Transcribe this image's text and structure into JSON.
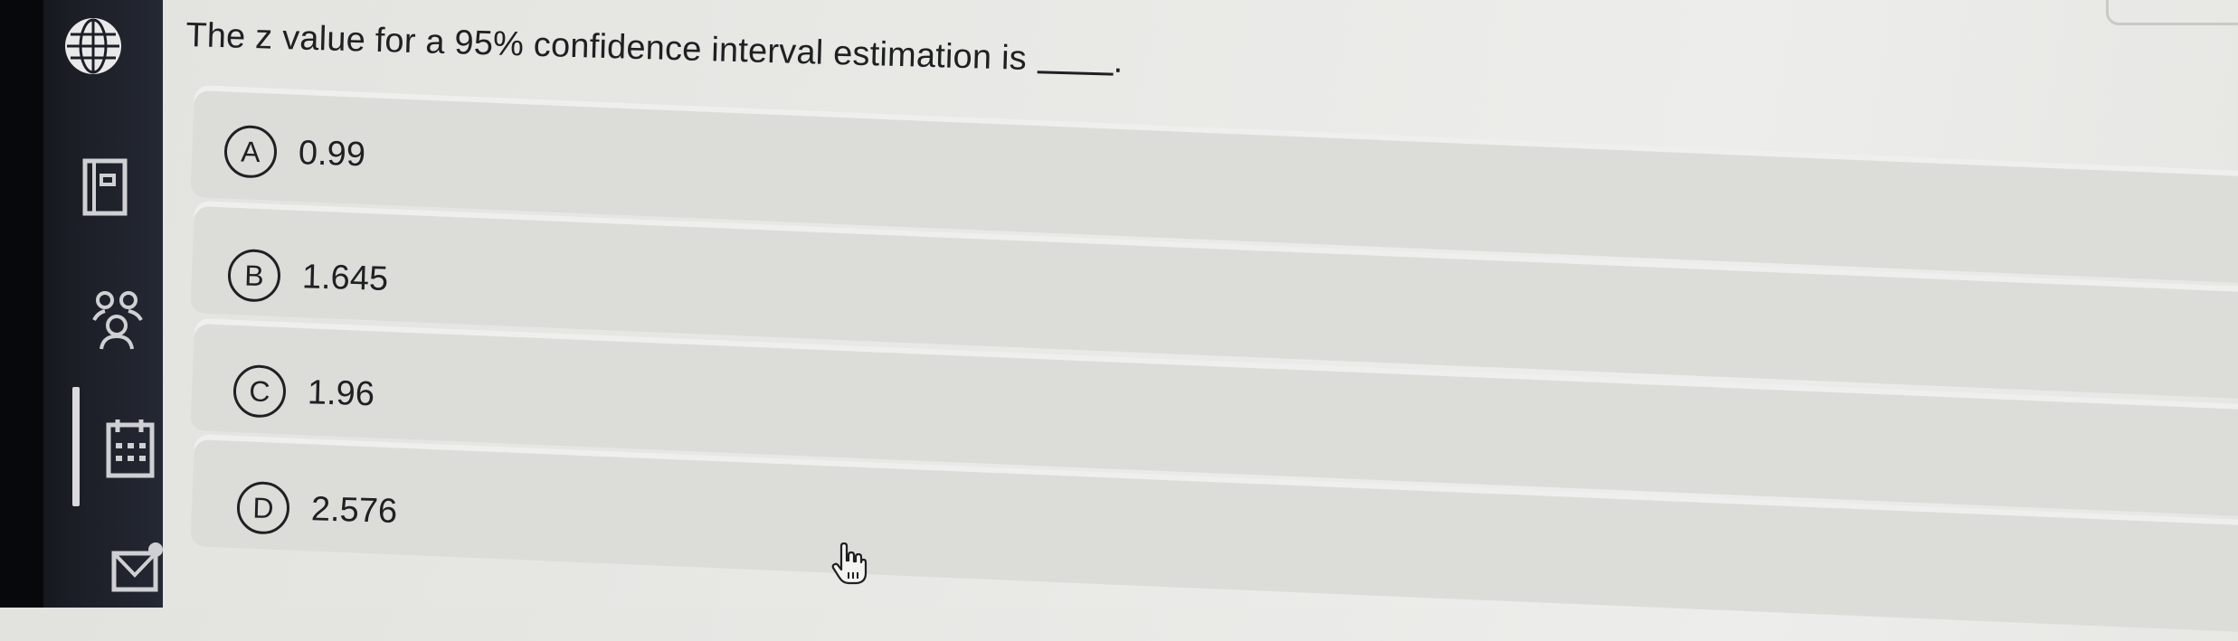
{
  "question": {
    "text": "The z value for a 95% confidence interval estimation is",
    "trailing": "."
  },
  "options": [
    {
      "letter": "A",
      "value": "0.99"
    },
    {
      "letter": "B",
      "value": "1.645"
    },
    {
      "letter": "C",
      "value": "1.96"
    },
    {
      "letter": "D",
      "value": "2.576"
    }
  ],
  "sidebar": {
    "icons": [
      "globe-icon",
      "book-icon",
      "people-icon",
      "calendar-icon",
      "mail-icon"
    ]
  },
  "colors": {
    "sidebar_bg": "#1b1e25",
    "page_bg": "#e8e8e5",
    "text": "#1f2022",
    "option_bg": "#dcdcd9"
  }
}
